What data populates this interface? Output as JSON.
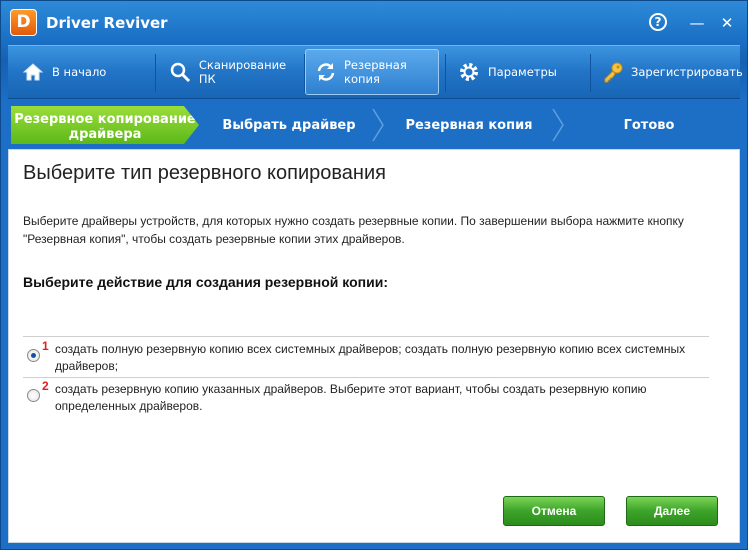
{
  "app": {
    "title": "Driver Reviver",
    "logo_letter": "D"
  },
  "window_controls": {
    "help": "?",
    "minimize": "—",
    "close": "✕"
  },
  "nav": {
    "items": [
      {
        "label": "В начало",
        "icon": "home-icon"
      },
      {
        "label": "Сканирование ПК",
        "icon": "magnifier-icon"
      },
      {
        "label": "Резервная копия",
        "icon": "refresh-icon",
        "active": true
      },
      {
        "label": "Параметры",
        "icon": "gear-icon"
      },
      {
        "label": "Зарегистрировать",
        "icon": "key-icon"
      }
    ]
  },
  "steps": {
    "items": [
      {
        "label": "Резервное копирование драйвера",
        "active": true
      },
      {
        "label": "Выбрать драйвер"
      },
      {
        "label": "Резервная копия"
      },
      {
        "label": "Готово"
      }
    ]
  },
  "page": {
    "title": "Выберите тип резервного копирования",
    "description": "Выберите драйверы устройств, для которых нужно создать резервные копии. По завершении выбора нажмите кнопку \"Резервная копия\", чтобы создать резервные копии этих драйверов.",
    "section_heading": "Выберите действие для создания резервной копии:",
    "options": [
      {
        "marker": "1",
        "text": "создать полную резервную копию всех системных драйверов; создать полную резервную копию всех системных драйверов;",
        "selected": true
      },
      {
        "marker": "2",
        "text": "создать резервную копию указанных драйверов. Выберите этот вариант, чтобы создать резервную копию определенных драйверов.",
        "selected": false
      }
    ]
  },
  "buttons": {
    "cancel": "Отмена",
    "next": "Далее"
  },
  "colors": {
    "accent_blue": "#1a6fc4",
    "step_active": "#5db81a",
    "button_green": "#3da42a",
    "marker_red": "#e02020"
  }
}
